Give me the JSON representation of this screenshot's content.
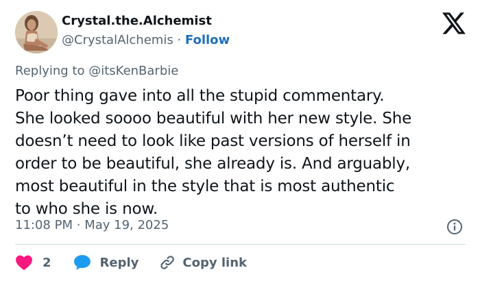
{
  "user": {
    "display_name": "Crystal.the.Alchemist",
    "handle": "@CrystalAlchemis",
    "separator": "·",
    "follow_label": "Follow"
  },
  "reply_context": {
    "prefix": "Replying to",
    "mention": "@itsKenBarbie"
  },
  "tweet": {
    "lines": [
      "Poor thing gave into all the stupid commentary.",
      "She looked soooo beautiful with her new style. She",
      "doesn’t need to look like past versions of herself in",
      "order to be beautiful, she already is. And arguably,",
      "most beautiful in the style that is most authentic",
      "to who she is now."
    ],
    "time": "11:08 PM",
    "date_separator": "·",
    "date": "May 19, 2025"
  },
  "actions": {
    "like_count": "2",
    "reply_label": "Reply",
    "copy_link_label": "Copy link"
  },
  "icons": {
    "brand": "x-logo-icon",
    "info": "info-icon",
    "like": "heart-icon",
    "reply": "speech-bubble-icon",
    "copy": "link-icon"
  },
  "colors": {
    "accent": "#1d9bf0",
    "follow": "#1d6fb8",
    "like": "#f91880",
    "text": "#0f1419",
    "muted": "#536471",
    "divider": "#cfd9de"
  }
}
